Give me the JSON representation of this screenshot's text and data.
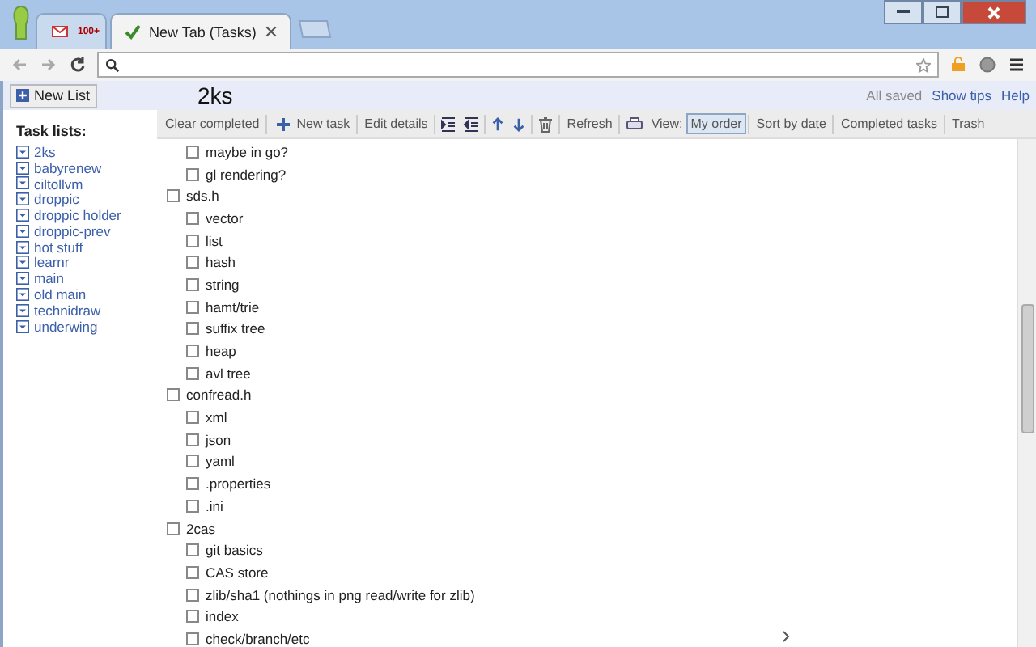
{
  "browser": {
    "tabs": [
      {
        "kind": "mail",
        "badge": "100+",
        "selected": false
      },
      {
        "kind": "page",
        "title": "New Tab (Tasks)",
        "selected": true
      }
    ]
  },
  "sidebar": {
    "new_list_button": "New List",
    "heading": "Task lists:",
    "lists": [
      "2ks",
      "babyrenew",
      "ciltollvm",
      "droppic",
      "droppic holder",
      "droppic-prev",
      "hot stuff",
      "learnr",
      "main",
      "old main",
      "technidraw",
      "underwing"
    ]
  },
  "header": {
    "title": "2ks",
    "status": "All saved",
    "links": [
      "Show tips",
      "Help"
    ]
  },
  "toolbar": {
    "clear_completed": "Clear completed",
    "new_task": "New task",
    "edit_details": "Edit details",
    "refresh": "Refresh",
    "view_label": "View:",
    "views": [
      {
        "label": "My order",
        "selected": true
      },
      {
        "label": "Sort by date",
        "selected": false
      },
      {
        "label": "Completed tasks",
        "selected": false
      },
      {
        "label": "Trash",
        "selected": false
      }
    ]
  },
  "tasks": [
    {
      "children": [
        {
          "title": "maybe in go?",
          "checked": false
        },
        {
          "title": "gl rendering?",
          "checked": false
        }
      ]
    },
    {
      "title": "sds.h",
      "checked": false,
      "children": [
        {
          "title": "vector",
          "checked": false
        },
        {
          "title": "list",
          "checked": false
        },
        {
          "title": "hash",
          "checked": false
        },
        {
          "title": "string",
          "checked": false
        },
        {
          "title": "hamt/trie",
          "checked": false
        },
        {
          "title": "suffix tree",
          "checked": false
        },
        {
          "title": "heap",
          "checked": false
        },
        {
          "title": "avl tree",
          "checked": false
        }
      ]
    },
    {
      "title": "confread.h",
      "checked": false,
      "children": [
        {
          "title": "xml",
          "checked": false
        },
        {
          "title": "json",
          "checked": false
        },
        {
          "title": "yaml",
          "checked": false
        },
        {
          "title": ".properties",
          "checked": false
        },
        {
          "title": ".ini",
          "checked": false
        }
      ]
    },
    {
      "title": "2cas",
      "checked": false,
      "children": [
        {
          "title": "git basics",
          "checked": false
        },
        {
          "title": "CAS store",
          "checked": false
        },
        {
          "title": "zlib/sha1 (nothings in png read/write for zlib)",
          "checked": false
        },
        {
          "title": "index",
          "checked": false
        },
        {
          "title": "check/branch/etc",
          "checked": false
        }
      ]
    }
  ]
}
